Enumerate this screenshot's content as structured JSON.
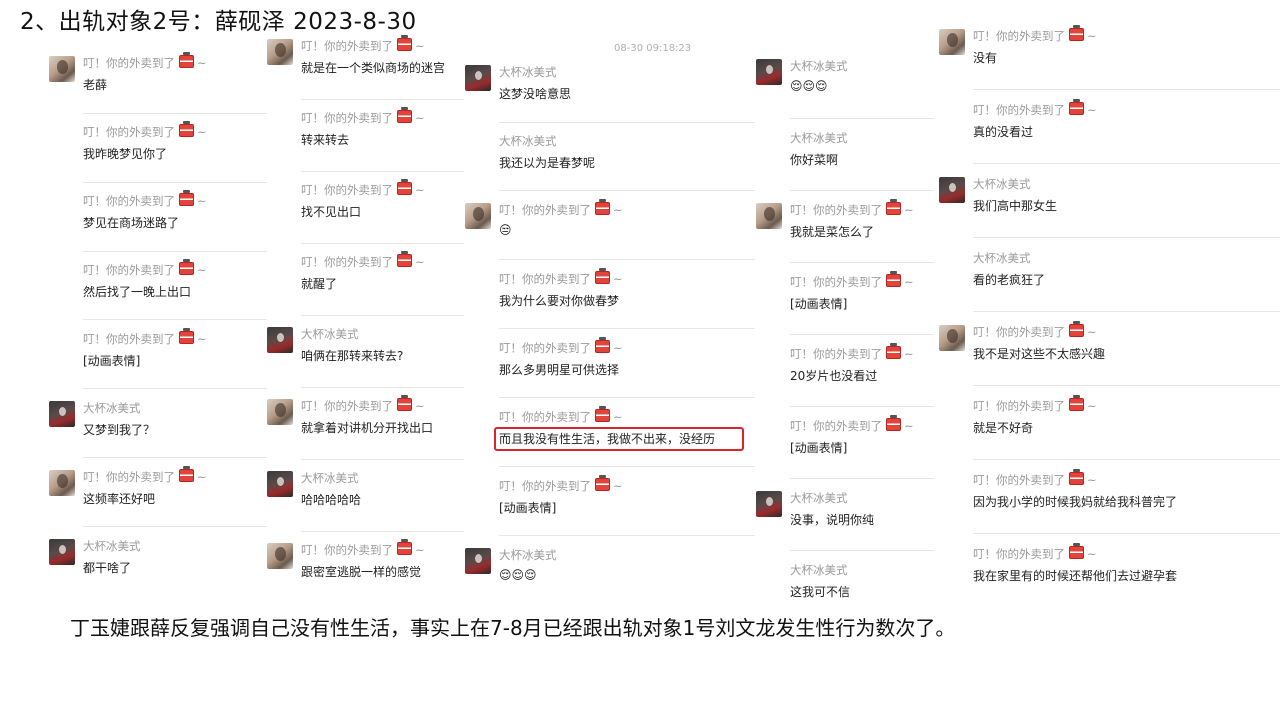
{
  "page_title": "2、出轨对象2号：薛砚泽 2023-8-30",
  "caption": "丁玉婕跟薛反复强调自己没有性生活，事实上在7-8月已经跟出轨对象1号刘文龙发生性行为数次了。",
  "timestamp": "08-30 09:18:23",
  "names": {
    "her": "叮！你的外卖到了",
    "her_suffix": "~",
    "him": "大杯冰美式"
  },
  "emoji_text": "😌😌😌",
  "columns": [
    {
      "messages": [
        {
          "who": "her",
          "text": "老薛"
        },
        {
          "who": "her",
          "text": "我昨晚梦见你了"
        },
        {
          "who": "her",
          "text": "梦见在商场迷路了"
        },
        {
          "who": "her",
          "text": "然后找了一晚上出口"
        },
        {
          "who": "her",
          "text": "[动画表情]"
        },
        {
          "who": "him",
          "text": "又梦到我了？"
        },
        {
          "who": "her",
          "text": "这频率还好吧"
        },
        {
          "who": "him",
          "text": "都干啥了"
        }
      ]
    },
    {
      "messages": [
        {
          "who": "her",
          "text": "就是在一个类似商场的迷宫"
        },
        {
          "who": "her",
          "text": "转来转去"
        },
        {
          "who": "her",
          "text": "找不见出口"
        },
        {
          "who": "her",
          "text": "就醒了"
        },
        {
          "who": "him",
          "text": "咱俩在那转来转去?"
        },
        {
          "who": "her",
          "text": "就拿着对讲机分开找出口"
        },
        {
          "who": "him",
          "text": "哈哈哈哈哈"
        },
        {
          "who": "her",
          "text": "跟密室逃脱一样的感觉"
        }
      ]
    },
    {
      "messages": [
        {
          "who": "him",
          "text": "这梦没啥意思"
        },
        {
          "who": "him",
          "text": "我还以为是春梦呢"
        },
        {
          "who": "her",
          "text": "😒"
        },
        {
          "who": "her",
          "text": "我为什么要对你做春梦"
        },
        {
          "who": "her",
          "text": "那么多男明星可供选择"
        },
        {
          "who": "her",
          "text": "而且我没有性生活，我做不出来，没经历"
        },
        {
          "who": "her",
          "text": "[动画表情]"
        },
        {
          "who": "him",
          "text": "😌😌😌"
        }
      ]
    },
    {
      "messages": [
        {
          "who": "him",
          "text": "😌😌😌"
        },
        {
          "who": "him",
          "text": "你好菜啊"
        },
        {
          "who": "her",
          "text": "我就是菜怎么了"
        },
        {
          "who": "her",
          "text": "[动画表情]"
        },
        {
          "who": "her",
          "text": "20岁片也没看过"
        },
        {
          "who": "her",
          "text": "[动画表情]"
        },
        {
          "who": "him",
          "text": "没事，说明你纯"
        },
        {
          "who": "him",
          "text": "这我可不信"
        }
      ]
    },
    {
      "messages": [
        {
          "who": "her",
          "text": "没有"
        },
        {
          "who": "her",
          "text": "真的没看过"
        },
        {
          "who": "him",
          "text": "我们高中那女生"
        },
        {
          "who": "him",
          "text": "看的老疯狂了"
        },
        {
          "who": "her",
          "text": "我不是对这些不太感兴趣"
        },
        {
          "who": "her",
          "text": "就是不好奇"
        },
        {
          "who": "her",
          "text": "因为我小学的时候我妈就给我科普完了"
        },
        {
          "who": "her",
          "text": "我在家里有的时候还帮他们去过避孕套"
        }
      ]
    }
  ]
}
